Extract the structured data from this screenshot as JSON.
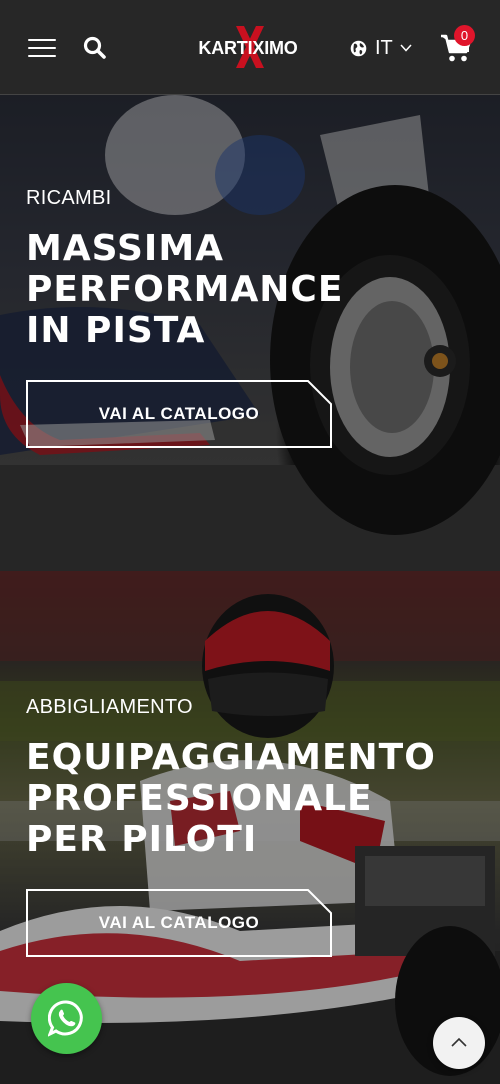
{
  "header": {
    "logo_text": "KARTIXIMO",
    "language": "IT",
    "cart_count": "0"
  },
  "sections": [
    {
      "eyebrow": "RICAMBI",
      "headline_lines": [
        "MASSIMA",
        "PERFORMANCE",
        "IN PISTA"
      ],
      "cta_label": "VAI AL CATALOGO"
    },
    {
      "eyebrow": "ABBIGLIAMENTO",
      "headline_lines": [
        "EQUIPAGGIAMENTO",
        "PROFESSIONALE",
        "PER PILOTI"
      ],
      "cta_label": "VAI AL CATALOGO"
    }
  ],
  "icons": {
    "menu": "hamburger-icon",
    "search": "search-icon",
    "language": "globe-icon",
    "cart": "cart-icon",
    "chat": "whatsapp-icon",
    "scroll": "chevron-up-icon"
  },
  "colors": {
    "header_bg": "#272727",
    "accent_red": "#e0152b",
    "whatsapp_green": "#45c44f"
  }
}
